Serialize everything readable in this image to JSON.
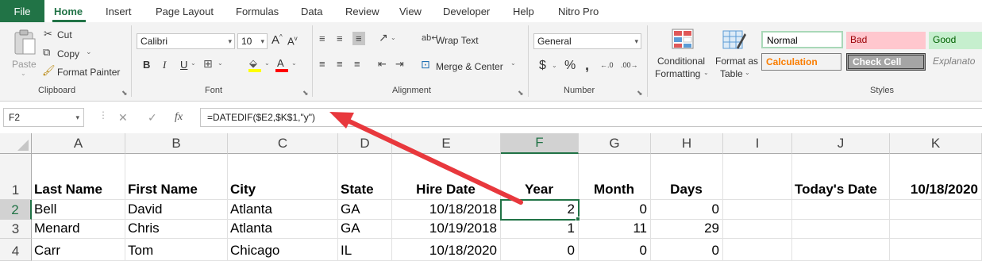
{
  "tabs": {
    "file": "File",
    "items": [
      "Home",
      "Insert",
      "Page Layout",
      "Formulas",
      "Data",
      "Review",
      "View",
      "Developer",
      "Help",
      "Nitro Pro"
    ]
  },
  "clipboard": {
    "paste": "Paste",
    "cut": "Cut",
    "copy": "Copy",
    "format_painter": "Format Painter",
    "label": "Clipboard"
  },
  "font": {
    "name": "Calibri",
    "size": "10",
    "label": "Font"
  },
  "alignment": {
    "wrap_text": "Wrap Text",
    "merge_center": "Merge & Center",
    "label": "Alignment"
  },
  "number": {
    "format": "General",
    "label": "Number"
  },
  "styles": {
    "conditional_formatting_1": "Conditional",
    "conditional_formatting_2": "Formatting",
    "format_table_1": "Format as",
    "format_table_2": "Table",
    "normal": "Normal",
    "bad": "Bad",
    "good": "Good",
    "calculation": "Calculation",
    "check_cell": "Check Cell",
    "explanatory": "Explanato",
    "label": "Styles",
    "colors": {
      "normal_border": "#a9d8b8",
      "bad_bg": "#ffc7ce",
      "bad_text": "#9c0006",
      "good_bg": "#c6efce",
      "good_text": "#006100",
      "calc_bg": "#f2f2f2",
      "calc_text": "#fa7d00",
      "check_bg": "#a5a5a5"
    }
  },
  "formula_bar": {
    "name_box": "F2",
    "formula": "=DATEDIF($E2,$K$1,\"y\")"
  },
  "columns": [
    "A",
    "B",
    "C",
    "D",
    "E",
    "F",
    "G",
    "H",
    "I",
    "J",
    "K"
  ],
  "rows": [
    {
      "num": "1",
      "cells": [
        "Last Name",
        "First Name",
        "City",
        "State",
        "Hire Date",
        "Year",
        "Month",
        "Days",
        "",
        "Today's Date",
        "10/18/2020"
      ]
    },
    {
      "num": "2",
      "cells": [
        "Bell",
        "David",
        "Atlanta",
        "GA",
        "10/18/2018",
        "2",
        "0",
        "0",
        "",
        "",
        ""
      ]
    },
    {
      "num": "3",
      "cells": [
        "Menard",
        "Chris",
        "Atlanta",
        "GA",
        "10/19/2018",
        "1",
        "11",
        "29",
        "",
        "",
        ""
      ]
    },
    {
      "num": "4",
      "cells": [
        "Carr",
        "Tom",
        "Chicago",
        "IL",
        "10/18/2020",
        "0",
        "0",
        "0",
        "",
        "",
        ""
      ]
    }
  ],
  "accent": "#217346",
  "annotation_arrow_color": "#e8383d"
}
